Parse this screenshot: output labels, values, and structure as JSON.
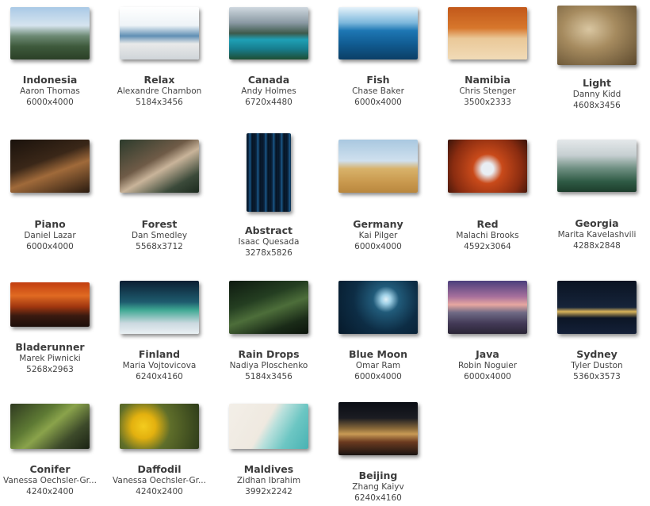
{
  "wallpapers": [
    {
      "title": "Indonesia",
      "author": "Aaron Thomas",
      "resolution": "6000x4000",
      "thumb_icon": "indonesia-thumbnail"
    },
    {
      "title": "Relax",
      "author": "Alexandre Chambon",
      "resolution": "5184x3456",
      "thumb_icon": "relax-thumbnail"
    },
    {
      "title": "Canada",
      "author": "Andy Holmes",
      "resolution": "6720x4480",
      "thumb_icon": "canada-thumbnail"
    },
    {
      "title": "Fish",
      "author": "Chase Baker",
      "resolution": "6000x4000",
      "thumb_icon": "fish-thumbnail"
    },
    {
      "title": "Namibia",
      "author": "Chris Stenger",
      "resolution": "3500x2333",
      "thumb_icon": "namibia-thumbnail"
    },
    {
      "title": "Light",
      "author": "Danny Kidd",
      "resolution": "4608x3456",
      "thumb_icon": "light-thumbnail"
    },
    {
      "title": "Piano",
      "author": "Daniel Lazar",
      "resolution": "6000x4000",
      "thumb_icon": "piano-thumbnail"
    },
    {
      "title": "Forest",
      "author": "Dan Smedley",
      "resolution": "5568x3712",
      "thumb_icon": "forest-thumbnail"
    },
    {
      "title": "Abstract",
      "author": "Isaac Quesada",
      "resolution": "3278x5826",
      "thumb_icon": "abstract-thumbnail"
    },
    {
      "title": "Germany",
      "author": "Kai Pilger",
      "resolution": "6000x4000",
      "thumb_icon": "germany-thumbnail"
    },
    {
      "title": "Red",
      "author": "Malachi Brooks",
      "resolution": "4592x3064",
      "thumb_icon": "red-thumbnail"
    },
    {
      "title": "Georgia",
      "author": "Marita Kavelashvili",
      "resolution": "4288x2848",
      "thumb_icon": "georgia-thumbnail"
    },
    {
      "title": "Bladerunner",
      "author": "Marek Piwnicki",
      "resolution": "5268x2963",
      "thumb_icon": "bladerunner-thumbnail"
    },
    {
      "title": "Finland",
      "author": "Maria Vojtovicova",
      "resolution": "6240x4160",
      "thumb_icon": "finland-thumbnail"
    },
    {
      "title": "Rain Drops",
      "author": "Nadiya Ploschenko",
      "resolution": "5184x3456",
      "thumb_icon": "raindrops-thumbnail"
    },
    {
      "title": "Blue Moon",
      "author": "Omar Ram",
      "resolution": "6000x4000",
      "thumb_icon": "bluemoon-thumbnail"
    },
    {
      "title": "Java",
      "author": "Robin Noguier",
      "resolution": "6000x4000",
      "thumb_icon": "java-thumbnail"
    },
    {
      "title": "Sydney",
      "author": "Tyler Duston",
      "resolution": "5360x3573",
      "thumb_icon": "sydney-thumbnail"
    },
    {
      "title": "Conifer",
      "author": "Vanessa Oechsler-Gr...",
      "resolution": "4240x2400",
      "thumb_icon": "conifer-thumbnail"
    },
    {
      "title": "Daffodil",
      "author": "Vanessa Oechsler-Gr...",
      "resolution": "4240x2400",
      "thumb_icon": "daffodil-thumbnail"
    },
    {
      "title": "Maldives",
      "author": "Zidhan Ibrahim",
      "resolution": "3992x2242",
      "thumb_icon": "maldives-thumbnail"
    },
    {
      "title": "Beijing",
      "author": "Zhang Kaiyv",
      "resolution": "6240x4160",
      "thumb_icon": "beijing-thumbnail"
    }
  ]
}
